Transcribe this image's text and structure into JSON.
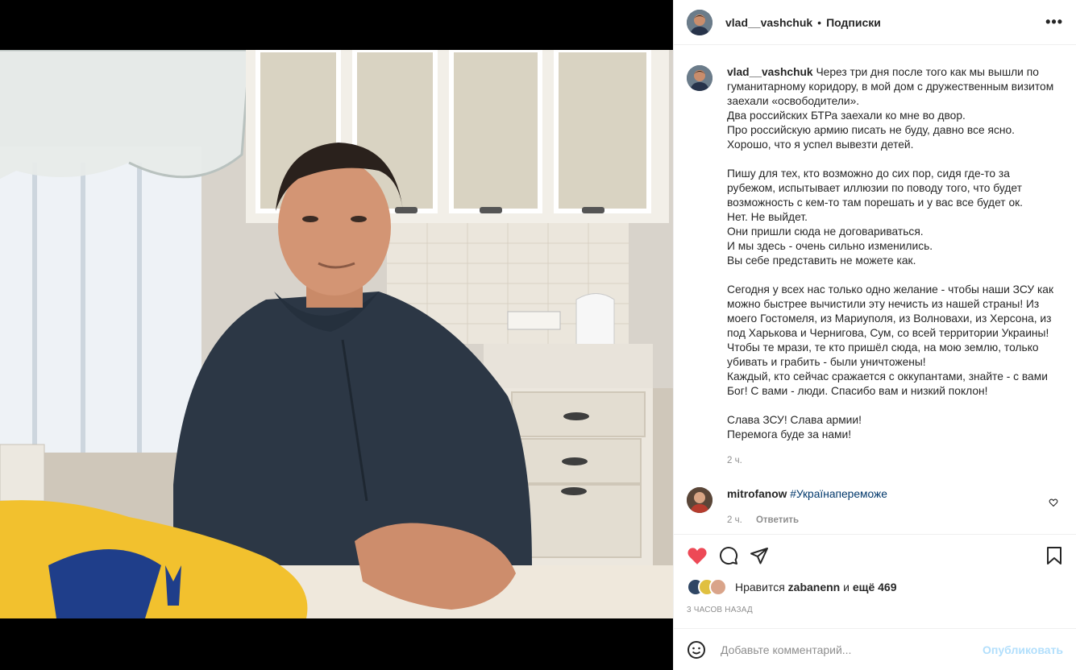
{
  "header": {
    "username": "vlad__vashchuk",
    "separator": "•",
    "follow_label": "Подписки",
    "more_label": "•••"
  },
  "caption": {
    "username": "vlad__vashchuk",
    "text": "Через три дня после того как мы вышли по гуманитарному коридору, в мой дом с дружественным визитом заехали «освободители».\nДва российских БТРа заехали ко мне во двор.\nПро российскую армию писать не буду, давно все ясно.\nХорошо, что я успел вывезти детей.\n\nПишу для тех, кто возможно до сих пор, сидя где-то за рубежом, испытывает иллюзии по поводу того, что будет возможность с кем-то там порешать и у вас все будет ок.\nНет. Не выйдет.\nОни пришли сюда не договариваться.\nИ мы здесь - очень сильно изменились.\nВы себе представить не можете как.\n\nСегодня у всех нас только одно желание - чтобы наши ЗСУ как можно быстрее вычистили эту нечисть из нашей страны! Из моего Гостомеля, из Мариуполя, из Волновахи, из Херсона, из под Харькова и Чернигова, Сум, со всей территории Украины! Чтобы те мрази, те кто пришёл сюда, на мою землю, только убивать и грабить - были уничтожены!\nКаждый, кто сейчас сражается с оккупантами, знайте - с вами Бог! С вами - люди. Спасибо вам и низкий поклон!\n\nСлава ЗСУ! Слава армии!\nПеремога буде за нами!",
    "time": "2 ч."
  },
  "comments": [
    {
      "username": "mitrofanow",
      "hashtag": "#Українапереможе",
      "time": "2 ч.",
      "reply_label": "Ответить"
    }
  ],
  "likes": {
    "prefix": "Нравится",
    "user": "zabanenn",
    "conj": "и",
    "others": "ещё 469"
  },
  "posted_ago": "3 ЧАСОВ НАЗАД",
  "add_comment": {
    "placeholder": "Добавьте комментарий...",
    "post_label": "Опубликовать"
  },
  "colors": {
    "liked_heart": "#ed4956",
    "post_button_disabled": "#b2dffc",
    "hashtag": "#00376b",
    "muted": "#8e8e8e"
  },
  "icons": [
    "more-icon",
    "heart-icon",
    "comment-icon",
    "share-icon",
    "bookmark-icon",
    "emoji-icon"
  ]
}
